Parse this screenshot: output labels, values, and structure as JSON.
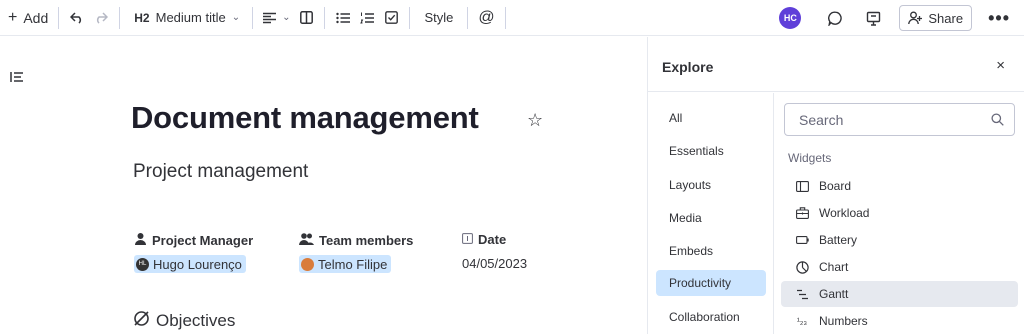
{
  "toolbar": {
    "add_label": "Add",
    "heading_mark": "H2",
    "heading_label": "Medium title",
    "style_label": "Style",
    "mention_label": "@",
    "avatar_initials": "HC",
    "share_label": "Share",
    "more_label": "•••"
  },
  "document": {
    "title": "Document management",
    "subtitle": "Project management",
    "fields": [
      {
        "label": "Project Manager",
        "icon": "person-icon",
        "value": "Hugo Lourenço",
        "avatar": "HL"
      },
      {
        "label": "Team members",
        "icon": "people-icon",
        "value": "Telmo Filipe"
      },
      {
        "label": "Date",
        "icon": "calendar-icon",
        "value": "04/05/2023"
      }
    ],
    "objectives_heading": "Objectives"
  },
  "explore": {
    "title": "Explore",
    "close_label": "×",
    "categories": [
      {
        "label": "All"
      },
      {
        "label": "Essentials"
      },
      {
        "label": "Layouts"
      },
      {
        "label": "Media"
      },
      {
        "label": "Embeds"
      },
      {
        "label": "Productivity",
        "active": true
      },
      {
        "label": "Collaboration"
      }
    ],
    "search_placeholder": "Search",
    "section_label": "Widgets",
    "widgets": [
      {
        "label": "Board",
        "icon": "board-icon"
      },
      {
        "label": "Workload",
        "icon": "workload-icon"
      },
      {
        "label": "Battery",
        "icon": "battery-icon"
      },
      {
        "label": "Chart",
        "icon": "chart-icon"
      },
      {
        "label": "Gantt",
        "icon": "gantt-icon",
        "active": true
      },
      {
        "label": "Numbers",
        "icon": "numbers-icon"
      }
    ]
  },
  "colors": {
    "accent": "#5f3fd9",
    "chip": "#cce5ff",
    "hover": "#e6e9ef",
    "text": "#323338"
  }
}
